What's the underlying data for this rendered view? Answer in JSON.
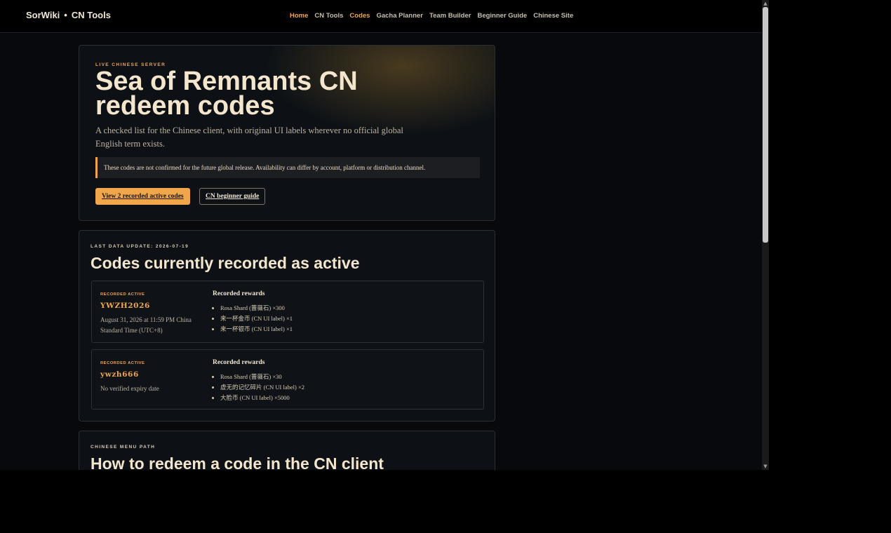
{
  "header": {
    "brand": "SorWiki",
    "brand_separator": "•",
    "brand_suffix": "CN Tools",
    "nav": [
      {
        "label": "Home",
        "active": true
      },
      {
        "label": "CN Tools",
        "active": false
      },
      {
        "label": "Codes",
        "active": true
      },
      {
        "label": "Gacha Planner",
        "active": false
      },
      {
        "label": "Team Builder",
        "active": false
      },
      {
        "label": "Beginner Guide",
        "active": false
      },
      {
        "label": "Chinese Site",
        "active": false
      }
    ]
  },
  "hero": {
    "eyebrow": "LIVE CHINESE SERVER",
    "title": "Sea of Remnants CN redeem codes",
    "lead": "A checked list for the Chinese client, with original UI labels wherever no official global English term exists.",
    "notice": "These codes are not confirmed for the future global release. Availability can differ by account, platform or distribution channel.",
    "primary_button": "View 2 recorded active codes",
    "secondary_button": "CN beginner guide"
  },
  "active_section": {
    "eyebrow": "LAST DATA UPDATE: 2026-07-19",
    "title": "Codes currently recorded as active",
    "codes": [
      {
        "status": "RECORDED ACTIVE",
        "code": "YWZH2026",
        "expiry": "August 31, 2026 at 11:59 PM China Standard Time (UTC+8)",
        "rewards_title": "Recorded rewards",
        "rewards": [
          "Rosa Shard (蔷薇石) ×300",
          "来一杯金币 (CN UI label) ×1",
          "来一杯银币 (CN UI label) ×1"
        ]
      },
      {
        "status": "RECORDED ACTIVE",
        "code": "ywzh666",
        "expiry": "No verified expiry date",
        "rewards_title": "Recorded rewards",
        "rewards": [
          "Rosa Shard (蔷薇石) ×30",
          "虚无的记忆碎片 (CN UI label) ×2",
          "大脸币 (CN UI label) ×5000"
        ]
      }
    ]
  },
  "howto_section": {
    "eyebrow": "CHINESE MENU PATH",
    "title": "How to redeem a code in the CN client"
  },
  "colors": {
    "accent": "#f0a64a",
    "background": "#07090c",
    "card": "#0d1116",
    "text": "#f3e6cc"
  }
}
